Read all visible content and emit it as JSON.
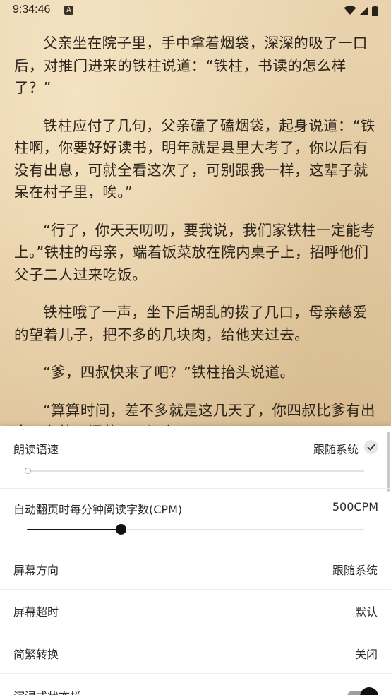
{
  "status_bar": {
    "time": "9:34:46",
    "notification_badge": "A",
    "icons": [
      "wifi-icon",
      "signal-icon",
      "battery-icon"
    ]
  },
  "reader": {
    "paragraphs": [
      "父亲坐在院子里，手中拿着烟袋，深深的吸了一口后，对推门进来的铁柱说道：“铁柱，书读的怎么样了？”",
      "铁柱应付了几句，父亲磕了磕烟袋，起身说道：“铁柱啊，你要好好读书，明年就是县里大考了，你以后有没有出息，可就全看这次了，可别跟我一样，这辈子就呆在村子里，唉。”",
      "“行了，你天天叨叨，要我说，我们家铁柱一定能考上。”铁柱的母亲，端着饭菜放在院内桌子上，招呼他们父子二人过来吃饭。",
      "铁柱哦了一声，坐下后胡乱的拨了几口，母亲慈爱的望着儿子，把不多的几块肉，给他夹过去。",
      "“爹，四叔快来了吧？”铁柱抬头说道。",
      "“算算时间，差不多就是这几天了，你四叔比爹有出息，在外面闯荡，见识多。”"
    ]
  },
  "settings": {
    "tts_speed": {
      "label": "朗读语速",
      "value": "跟随系统",
      "checked": true,
      "slider_fraction": 0.0
    },
    "auto_page_cpm": {
      "label": "自动翻页时每分钟阅读字数(CPM)",
      "value": "500CPM",
      "slider_fraction": 0.28
    },
    "screen_orientation": {
      "label": "屏幕方向",
      "value": "跟随系统"
    },
    "screen_timeout": {
      "label": "屏幕超时",
      "value": "默认"
    },
    "traditional_conversion": {
      "label": "简繁转换",
      "value": "关闭"
    },
    "immersive_status_bar": {
      "label": "沉浸式状态栏",
      "enabled": true
    }
  }
}
